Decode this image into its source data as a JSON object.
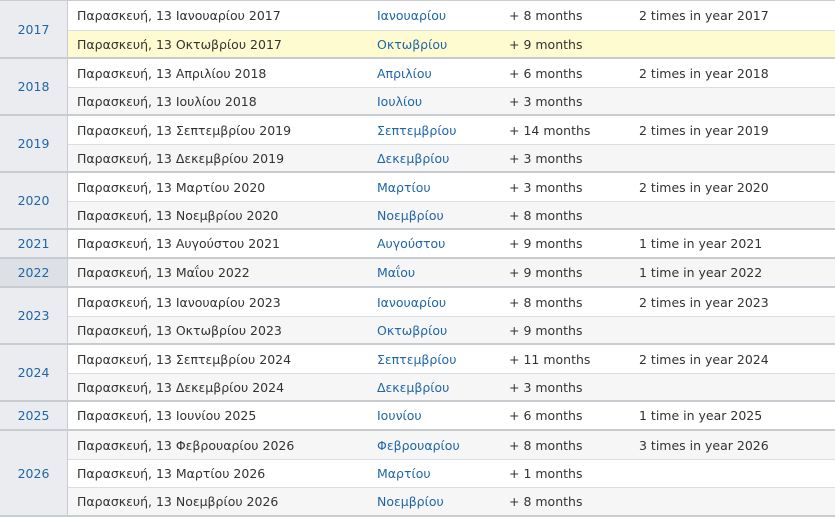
{
  "groups": [
    {
      "year": "2017",
      "rows": [
        {
          "date": "Παρασκευή, 13 Ιανουαρίου 2017",
          "month": "Ιανουαρίου",
          "diff": "+ 8 months",
          "count": "2 times in year 2017"
        },
        {
          "date": "Παρασκευή, 13 Οκτωβρίου 2017",
          "month": "Οκτωβρίου",
          "diff": "+ 9 months",
          "count": ""
        }
      ]
    },
    {
      "year": "2018",
      "rows": [
        {
          "date": "Παρασκευή, 13 Απριλίου 2018",
          "month": "Απριλίου",
          "diff": "+ 6 months",
          "count": "2 times in year 2018"
        },
        {
          "date": "Παρασκευή, 13 Ιουλίου 2018",
          "month": "Ιουλίου",
          "diff": "+ 3 months",
          "count": ""
        }
      ]
    },
    {
      "year": "2019",
      "rows": [
        {
          "date": "Παρασκευή, 13 Σεπτεμβρίου 2019",
          "month": "Σεπτεμβρίου",
          "diff": "+ 14 months",
          "count": "2 times in year 2019"
        },
        {
          "date": "Παρασκευή, 13 Δεκεμβρίου 2019",
          "month": "Δεκεμβρίου",
          "diff": "+ 3 months",
          "count": ""
        }
      ]
    },
    {
      "year": "2020",
      "rows": [
        {
          "date": "Παρασκευή, 13 Μαρτίου 2020",
          "month": "Μαρτίου",
          "diff": "+ 3 months",
          "count": "2 times in year 2020"
        },
        {
          "date": "Παρασκευή, 13 Νοεμβρίου 2020",
          "month": "Νοεμβρίου",
          "diff": "+ 8 months",
          "count": ""
        }
      ]
    },
    {
      "year": "2021",
      "rows": [
        {
          "date": "Παρασκευή, 13 Αυγούστου 2021",
          "month": "Αυγούστου",
          "diff": "+ 9 months",
          "count": "1 time in year 2021"
        }
      ]
    },
    {
      "year": "2022",
      "rows": [
        {
          "date": "Παρασκευή, 13 Μαΐου 2022",
          "month": "Μαΐου",
          "diff": "+ 9 months",
          "count": "1 time in year 2022"
        }
      ]
    },
    {
      "year": "2023",
      "rows": [
        {
          "date": "Παρασκευή, 13 Ιανουαρίου 2023",
          "month": "Ιανουαρίου",
          "diff": "+ 8 months",
          "count": "2 times in year 2023"
        },
        {
          "date": "Παρασκευή, 13 Οκτωβρίου 2023",
          "month": "Οκτωβρίου",
          "diff": "+ 9 months",
          "count": ""
        }
      ]
    },
    {
      "year": "2024",
      "rows": [
        {
          "date": "Παρασκευή, 13 Σεπτεμβρίου 2024",
          "month": "Σεπτεμβρίου",
          "diff": "+ 11 months",
          "count": "2 times in year 2024"
        },
        {
          "date": "Παρασκευή, 13 Δεκεμβρίου 2024",
          "month": "Δεκεμβρίου",
          "diff": "+ 3 months",
          "count": ""
        }
      ]
    },
    {
      "year": "2025",
      "rows": [
        {
          "date": "Παρασκευή, 13 Ιουνίου 2025",
          "month": "Ιουνίου",
          "diff": "+ 6 months",
          "count": "1 time in year 2025"
        }
      ]
    },
    {
      "year": "2026",
      "rows": [
        {
          "date": "Παρασκευή, 13 Φεβρουαρίου 2026",
          "month": "Φεβρουαρίου",
          "diff": "+ 8 months",
          "count": "3 times in year 2026"
        },
        {
          "date": "Παρασκευή, 13 Μαρτίου 2026",
          "month": "Μαρτίου",
          "diff": "+ 1 months",
          "count": ""
        },
        {
          "date": "Παρασκευή, 13 Νοεμβρίου 2026",
          "month": "Νοεμβρίου",
          "diff": "+ 8 months",
          "count": ""
        }
      ]
    }
  ]
}
